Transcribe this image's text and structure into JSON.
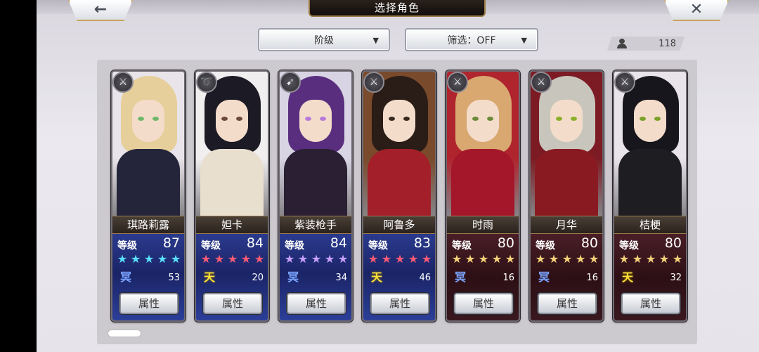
{
  "header": {
    "title": "选择角色"
  },
  "nav": {
    "back_glyph": "←",
    "close_glyph": "✕"
  },
  "filters": {
    "rank": {
      "label": "阶级",
      "caret": "▼"
    },
    "filter": {
      "label": "筛选：OFF",
      "caret": "▼"
    }
  },
  "roster": {
    "count": "118"
  },
  "common": {
    "level_label": "等级",
    "attr_label": "属性"
  },
  "characters": [
    {
      "name": "琪路莉露",
      "level": "87",
      "stars": 5,
      "star_color": "cyan",
      "align": "冥",
      "align_type": "dark",
      "align_value": "53",
      "bg": "blue",
      "type_icon": "sword-icon",
      "type_glyph": "⚔",
      "hair": "#e6cf9a",
      "outfit": "#24253a",
      "eye": "#6fb86a",
      "backdrop": "#e9e4ea"
    },
    {
      "name": "妲卡",
      "level": "84",
      "stars": 5,
      "star_color": "red",
      "align": "天",
      "align_type": "light",
      "align_value": "20",
      "bg": "blue",
      "type_icon": "whip-icon",
      "type_glyph": "➰",
      "hair": "#1c1a24",
      "outfit": "#e8dfcf",
      "eye": "#6b4a3a",
      "backdrop": "#f1eef0"
    },
    {
      "name": "紫装枪手",
      "level": "84",
      "stars": 5,
      "star_color": "purple",
      "align": "冥",
      "align_type": "dark",
      "align_value": "34",
      "bg": "blue",
      "type_icon": "gun-icon",
      "type_glyph": "➹",
      "hair": "#5a2e7e",
      "outfit": "#2a1f33",
      "eye": "#b77ad8",
      "backdrop": "#d8d4e4"
    },
    {
      "name": "阿鲁多",
      "level": "83",
      "stars": 5,
      "star_color": "red",
      "align": "天",
      "align_type": "light",
      "align_value": "46",
      "bg": "blue",
      "type_icon": "sword-icon",
      "type_glyph": "⚔",
      "hair": "#2a1c16",
      "outfit": "#a3202a",
      "eye": "#3a2a1e",
      "backdrop": "#7a4a2c"
    },
    {
      "name": "时雨",
      "level": "80",
      "stars": 5,
      "star_color": "gold",
      "align": "冥",
      "align_type": "dark",
      "align_value": "16",
      "bg": "red",
      "type_icon": "sword-icon",
      "type_glyph": "⚔",
      "hair": "#d8a870",
      "outfit": "#a4162a",
      "eye": "#6a8a3a",
      "backdrop": "#b0242d"
    },
    {
      "name": "月华",
      "level": "80",
      "stars": 5,
      "star_color": "gold",
      "align": "冥",
      "align_type": "dark",
      "align_value": "16",
      "bg": "red",
      "type_icon": "blade-icon",
      "type_glyph": "⚔",
      "hair": "#c8c6bc",
      "outfit": "#8a1a22",
      "eye": "#8ab02a",
      "backdrop": "#7c1b23"
    },
    {
      "name": "桔梗",
      "level": "80",
      "stars": 5,
      "star_color": "gold",
      "align": "天",
      "align_type": "light",
      "align_value": "32",
      "bg": "red",
      "type_icon": "sword-icon",
      "type_glyph": "⚔",
      "hair": "#17161c",
      "outfit": "#1e1d22",
      "eye": "#7aa22a",
      "backdrop": "#e8e4ea"
    }
  ]
}
